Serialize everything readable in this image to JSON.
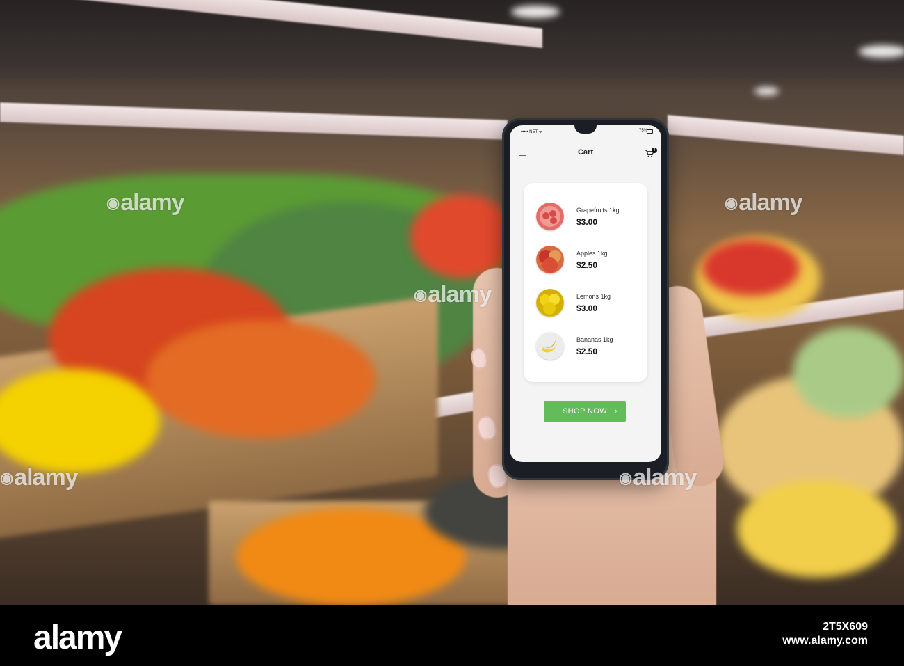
{
  "app": {
    "status_bar": {
      "carrier": "••••• NET ᯤ",
      "battery": "75%"
    },
    "title": "Cart",
    "cart_badge": "4",
    "items": [
      {
        "name": "Grapefruits  1kg",
        "price": "$3.00",
        "icon": "grapefruit-icon"
      },
      {
        "name": "Apples  1kg",
        "price": "$2.50",
        "icon": "apples-icon"
      },
      {
        "name": "Lemons  1kg",
        "price": "$3.00",
        "icon": "lemons-icon"
      },
      {
        "name": "Bananas  1kg",
        "price": "$2.50",
        "icon": "bananas-icon"
      }
    ],
    "cta": "SHOP NOW",
    "cta_chevron": "›"
  },
  "watermark": {
    "text": "alamy",
    "mark": "◉"
  },
  "footer": {
    "brand": "alamy",
    "image_id": "2T5X609",
    "site": "www.alamy.com"
  },
  "colors": {
    "accent": "#63bb5a",
    "footer_bg": "#000000"
  }
}
